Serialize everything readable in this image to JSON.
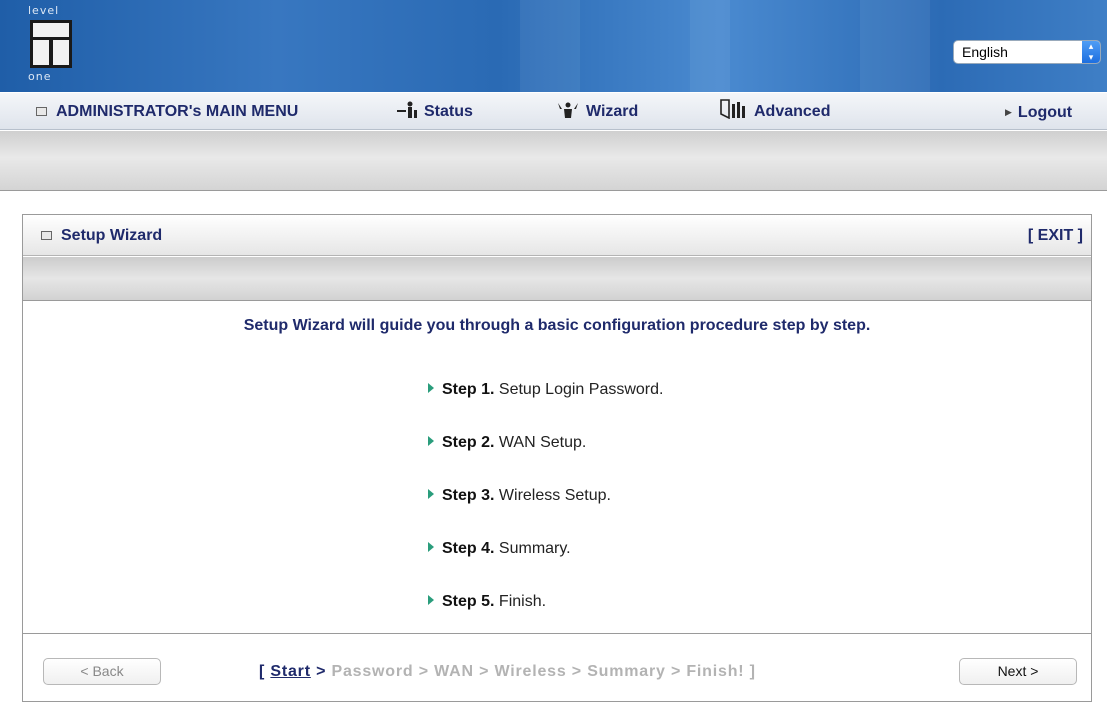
{
  "header": {
    "logo_top": "level",
    "logo_bottom": "one",
    "language": "English"
  },
  "menu": {
    "admin": "ADMINISTRATOR's MAIN MENU",
    "status": "Status",
    "wizard": "Wizard",
    "advanced": "Advanced",
    "logout": "Logout"
  },
  "wizard": {
    "title": "Setup Wizard",
    "exit": "[ EXIT ]",
    "intro": "Setup Wizard will guide you through a basic configuration procedure step by step.",
    "steps": [
      {
        "label": "Step 1.",
        "text": " Setup Login Password."
      },
      {
        "label": "Step 2.",
        "text": " WAN Setup."
      },
      {
        "label": "Step 3.",
        "text": " Wireless Setup."
      },
      {
        "label": "Step 4.",
        "text": " Summary."
      },
      {
        "label": "Step 5.",
        "text": " Finish."
      }
    ],
    "back_label": "< Back",
    "next_label": "Next >",
    "progress": {
      "open": "[ ",
      "current": "Start",
      "rest": [
        " > Password",
        " > WAN",
        " > Wireless",
        " > Summary",
        " > Finish!"
      ],
      "close": " ]"
    }
  },
  "colors": {
    "accent_text": "#1f2a6b",
    "banner": "#2a6ab4",
    "step_bullet": "#2a9d7c",
    "inactive_text": "#b3b3b3"
  }
}
